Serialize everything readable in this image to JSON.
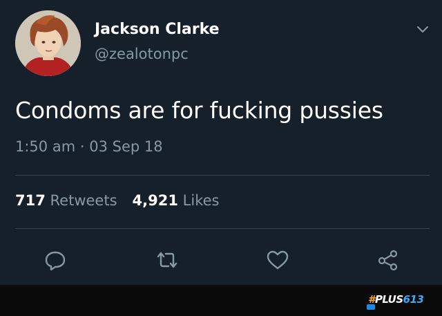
{
  "tweet": {
    "author_name": "Jackson Clarke",
    "author_handle": "@zealotonpc",
    "text": "Condoms are for fucking pussies",
    "time": "1:50 am",
    "separator": "·",
    "date": "03 Sep 18",
    "retweets_count": "717",
    "retweets_label": "Retweets",
    "likes_count": "4,921",
    "likes_label": "Likes"
  },
  "icons": {
    "menu": "chevron-down-icon",
    "reply": "reply-icon",
    "retweet": "retweet-icon",
    "like": "heart-icon",
    "share": "share-icon"
  },
  "watermark": {
    "hash": "#",
    "word": "PLUS",
    "number": "613"
  },
  "colors": {
    "background": "#15202b",
    "secondary_text": "#8899a6",
    "divider": "#38444d"
  }
}
